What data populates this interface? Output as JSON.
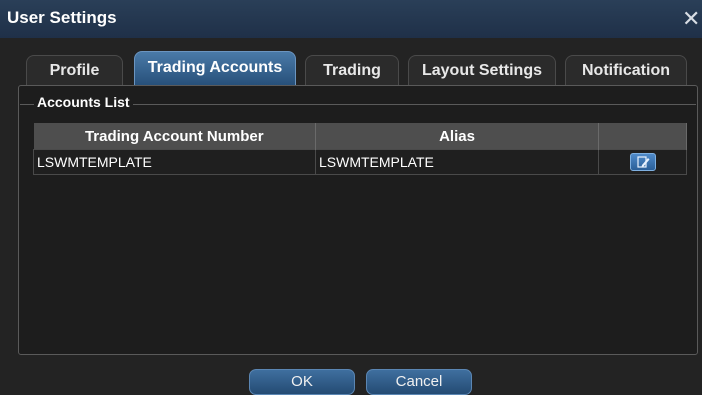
{
  "window": {
    "title": "User Settings",
    "close_glyph": "✕"
  },
  "tabs": [
    {
      "label": "Profile",
      "active": false
    },
    {
      "label": "Trading Accounts",
      "active": true
    },
    {
      "label": "Trading",
      "active": false
    },
    {
      "label": "Layout Settings",
      "active": false
    },
    {
      "label": "Notification",
      "active": false
    }
  ],
  "accounts_list": {
    "label": "Accounts List",
    "columns": [
      "Trading Account Number",
      "Alias",
      ""
    ],
    "rows": [
      {
        "account_number": "LSWMTEMPLATE",
        "alias": "LSWMTEMPLATE",
        "action_icon": "edit-icon"
      }
    ]
  },
  "buttons": {
    "ok": "OK",
    "cancel": "Cancel"
  },
  "colors": {
    "accent": "#3f6f9f",
    "titlebar": "#23364e",
    "background": "#232323"
  }
}
